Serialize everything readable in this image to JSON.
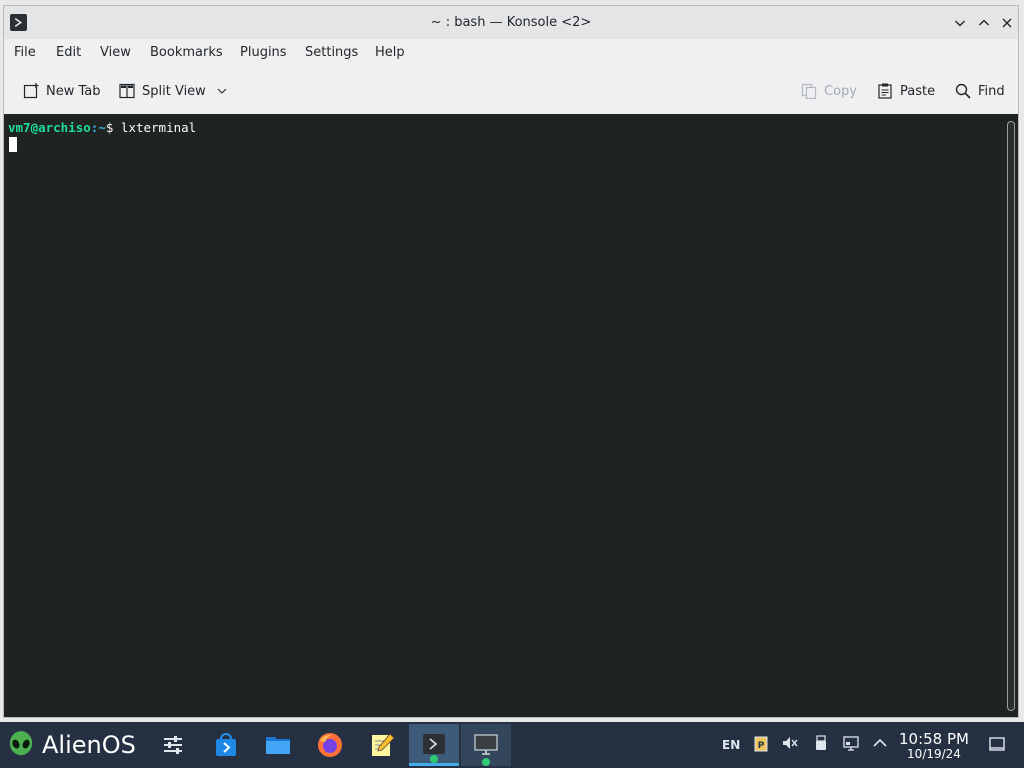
{
  "window": {
    "title": "~ : bash — Konsole <2>",
    "icon": "terminal-icon"
  },
  "menubar": {
    "items": [
      "File",
      "Edit",
      "View",
      "Bookmarks",
      "Plugins",
      "Settings",
      "Help"
    ]
  },
  "toolbar": {
    "new_tab": "New Tab",
    "split_view": "Split View",
    "copy": "Copy",
    "paste": "Paste",
    "find": "Find"
  },
  "terminal": {
    "prompt_user": "vm7@archiso",
    "prompt_path": ":~",
    "prompt_symbol": "$",
    "command": "lxterminal",
    "colors": {
      "background": "#1f2422",
      "user": "#1cdc9a",
      "path": "#3daee9",
      "text": "#fcfcfc"
    }
  },
  "taskbar": {
    "start_label": "AlienOS",
    "tasks": [
      {
        "icon": "settings-sliders-icon"
      },
      {
        "icon": "software-store-icon"
      },
      {
        "icon": "file-manager-icon"
      },
      {
        "icon": "firefox-icon"
      },
      {
        "icon": "text-editor-icon"
      },
      {
        "icon": "konsole-icon",
        "state": "active"
      },
      {
        "icon": "monitor-icon",
        "state": "running"
      }
    ],
    "tray": {
      "language": "EN"
    },
    "clock": {
      "time": "10:58 PM",
      "date": "10/19/24"
    },
    "colors": {
      "background": "#253142",
      "accent": "#3daee9"
    }
  }
}
